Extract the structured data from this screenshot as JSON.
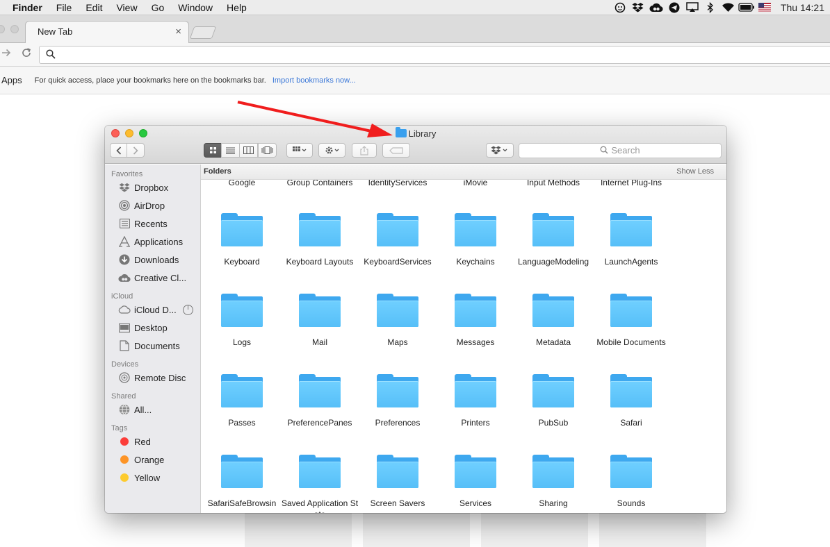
{
  "menubar": {
    "app": "Finder",
    "items": [
      "File",
      "Edit",
      "View",
      "Go",
      "Window",
      "Help"
    ],
    "status_icons": [
      "gauge-icon",
      "dropbox-icon",
      "creative-cloud-icon",
      "telegram-icon",
      "airplay-icon",
      "bluetooth-icon",
      "wifi-icon",
      "battery-icon",
      "flag-icon"
    ],
    "clock": "Thu 14:21"
  },
  "browser": {
    "tab_title": "New Tab",
    "tab_close": "×",
    "omnibox_value": "",
    "bookmarks": {
      "apps_label": "Apps",
      "hint": "For quick access, place your bookmarks here on the bookmarks bar.",
      "import_link": "Import bookmarks now..."
    }
  },
  "finder": {
    "title": "Library",
    "search_placeholder": "Search",
    "view_buttons": [
      "icon-view",
      "list-view",
      "column-view",
      "cover-flow-view"
    ],
    "active_view": "icon-view",
    "sidebar": {
      "sections": [
        {
          "heading": "Favorites",
          "items": [
            {
              "label": "Dropbox",
              "icon": "dropbox-icon"
            },
            {
              "label": "AirDrop",
              "icon": "airdrop-icon"
            },
            {
              "label": "Recents",
              "icon": "recents-icon"
            },
            {
              "label": "Applications",
              "icon": "applications-icon"
            },
            {
              "label": "Downloads",
              "icon": "downloads-icon"
            },
            {
              "label": "Creative Cl...",
              "icon": "creative-cloud-icon"
            }
          ]
        },
        {
          "heading": "iCloud",
          "items": [
            {
              "label": "iCloud D...",
              "icon": "icloud-icon"
            },
            {
              "label": "Desktop",
              "icon": "desktop-icon"
            },
            {
              "label": "Documents",
              "icon": "documents-icon"
            }
          ]
        },
        {
          "heading": "Devices",
          "items": [
            {
              "label": "Remote Disc",
              "icon": "disc-icon"
            }
          ]
        },
        {
          "heading": "Shared",
          "items": [
            {
              "label": "All...",
              "icon": "network-icon"
            }
          ]
        },
        {
          "heading": "Tags",
          "items": [
            {
              "label": "Red",
              "tag_color": "#fc3d39"
            },
            {
              "label": "Orange",
              "tag_color": "#fd9426"
            },
            {
              "label": "Yellow",
              "tag_color": "#fdcb2e"
            }
          ]
        }
      ]
    },
    "content": {
      "section_title": "Folders",
      "show_less": "Show Less",
      "partial_row": [
        "Google",
        "Group Containers",
        "IdentityServices",
        "iMovie",
        "Input Methods",
        "Internet Plug-Ins"
      ],
      "rows": [
        [
          "Keyboard",
          "Keyboard Layouts",
          "KeyboardServices",
          "Keychains",
          "LanguageModeling",
          "LaunchAgents"
        ],
        [
          "Logs",
          "Mail",
          "Maps",
          "Messages",
          "Metadata",
          "Mobile Documents"
        ],
        [
          "Passes",
          "PreferencePanes",
          "Preferences",
          "Printers",
          "PubSub",
          "Safari"
        ],
        [
          "SafariSafeBrowsin",
          "Saved Application State",
          "Screen Savers",
          "Services",
          "Sharing",
          "Sounds"
        ]
      ]
    }
  },
  "colors": {
    "folder": "#56bff8",
    "arrow": "#f01d1d",
    "link": "#3b78d8"
  }
}
